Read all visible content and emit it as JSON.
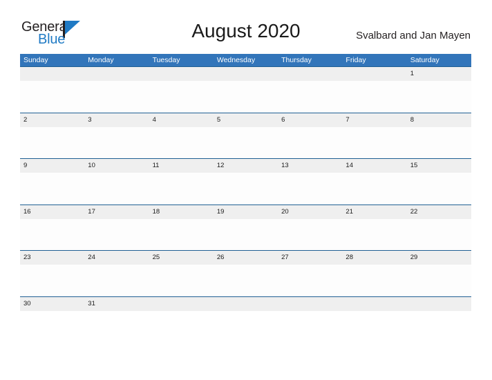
{
  "brand": {
    "name_part1": "General",
    "name_part2": "Blue",
    "color_dark": "#231f20",
    "color_blue": "#1f7ac4"
  },
  "header": {
    "title": "August 2020",
    "locale": "Svalbard and Jan Mayen"
  },
  "theme": {
    "header_blue": "#3275ba",
    "divider_blue": "#1f5f93",
    "band_gray": "#efefef",
    "cell_white": "#fdfdfd"
  },
  "calendar": {
    "month": "August",
    "year": "2020",
    "weekdays": [
      "Sunday",
      "Monday",
      "Tuesday",
      "Wednesday",
      "Thursday",
      "Friday",
      "Saturday"
    ],
    "weeks": [
      [
        "",
        "",
        "",
        "",
        "",
        "",
        "1"
      ],
      [
        "2",
        "3",
        "4",
        "5",
        "6",
        "7",
        "8"
      ],
      [
        "9",
        "10",
        "11",
        "12",
        "13",
        "14",
        "15"
      ],
      [
        "16",
        "17",
        "18",
        "19",
        "20",
        "21",
        "22"
      ],
      [
        "23",
        "24",
        "25",
        "26",
        "27",
        "28",
        "29"
      ],
      [
        "30",
        "31",
        "",
        "",
        "",
        "",
        ""
      ]
    ]
  }
}
